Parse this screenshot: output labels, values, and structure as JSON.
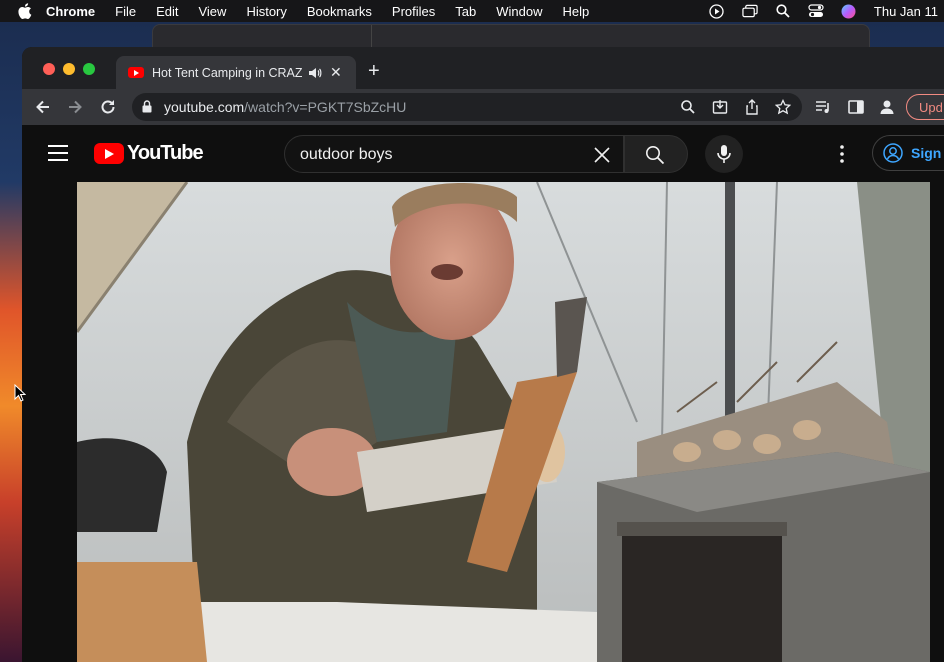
{
  "menubar": {
    "app": "Chrome",
    "items": [
      "File",
      "Edit",
      "View",
      "History",
      "Bookmarks",
      "Profiles",
      "Tab",
      "Window",
      "Help"
    ],
    "clock": "Thu Jan 11"
  },
  "background_window": {
    "title": ""
  },
  "tab": {
    "title": "Hot Tent Camping in CRAZ",
    "close": "✕"
  },
  "newtab_label": "+",
  "address": {
    "host": "youtube.com",
    "path": "/watch?v=PGKT7SbZcHU"
  },
  "update_label": "Upd",
  "youtube": {
    "logo_text": "YouTube",
    "search_value": "outdoor boys",
    "signin_label": "Sign i"
  },
  "colors": {
    "yt_red": "#ff0000",
    "link_blue": "#3ea6ff",
    "update_red": "#f28b82"
  },
  "icons": [
    "apple-icon",
    "play-circle-icon",
    "windows-icon",
    "search-icon",
    "control-center-icon",
    "siri-icon",
    "youtube-favicon",
    "speaker-icon",
    "back-icon",
    "forward-icon",
    "reload-icon",
    "lock-icon",
    "zoom-icon",
    "install-icon",
    "share-icon",
    "star-icon",
    "media-icon",
    "sidepanel-icon",
    "profile-icon",
    "menu-icon",
    "clear-icon",
    "mic-icon",
    "more-icon",
    "account-icon",
    "cursor-icon"
  ]
}
